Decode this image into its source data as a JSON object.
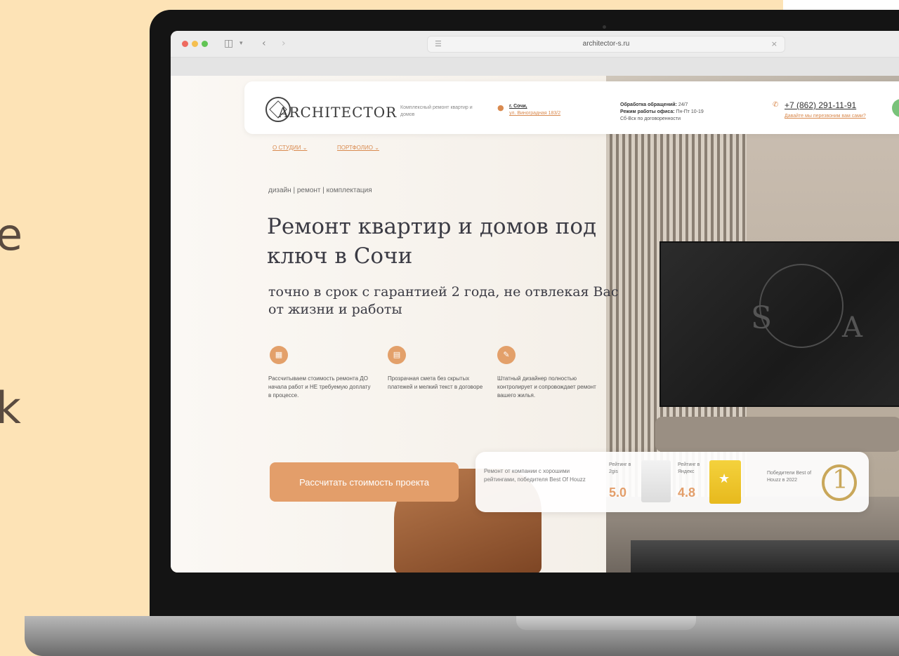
{
  "browser": {
    "url": "architector-s.ru"
  },
  "background_letters": [
    "e",
    "k"
  ],
  "header": {
    "brand": "ARCHITECTOR",
    "tagline": "Комплексный ремонт квартир и домов",
    "city": "г. Сочи,",
    "street": "ул. Виноградная 183/2",
    "hours_line1_label": "Обработка обращений:",
    "hours_line1_value": "24/7",
    "hours_line2_label": "Режим работы офиса:",
    "hours_line2_value": "Пн-Пт 10-19",
    "hours_line3": "Сб-Вск по договоренности",
    "phone": "+7 (862) 291-11-91",
    "callback": "Давайте мы перезвоним вам сами?"
  },
  "nav": [
    {
      "label": "О СТУДИИ ⌄"
    },
    {
      "label": "ПОРТФОЛИО ⌄"
    }
  ],
  "hero": {
    "kicker": "дизайн | ремонт | комплектация",
    "title": "Ремонт квартир и домов под ключ в Сочи",
    "subtitle": "точно в срок с гарантией 2 года, не отвлекая Вас от жизни и работы",
    "features": [
      {
        "icon": "calculator-icon",
        "text": "Рассчитываем стоимость ремонта ДО начала работ и НЕ требуемую доплату в процессе."
      },
      {
        "icon": "document-icon",
        "text": "Прозрачная смета без скрытых платежей и мелкий текст в договоре"
      },
      {
        "icon": "designer-icon",
        "text": "Штатный дизайнер полностью контролирует и сопровождает ремонт вашего жилья."
      }
    ],
    "cta": "Рассчитать стоимость проекта"
  },
  "ratings": {
    "intro": "Ремонт от компании с хорошими рейтингами, победителя Best Of Houzz",
    "items": [
      {
        "label": "Рейтинг в 2gis",
        "score": "5.0"
      },
      {
        "label": "Рейтинг в Яндекс",
        "score": "4.8"
      }
    ],
    "houzz": "Победители Best of Houzz в 2022"
  },
  "colors": {
    "page_bg": "#fde3b6",
    "accent": "#e39e6a",
    "heading": "#3b3b44"
  }
}
